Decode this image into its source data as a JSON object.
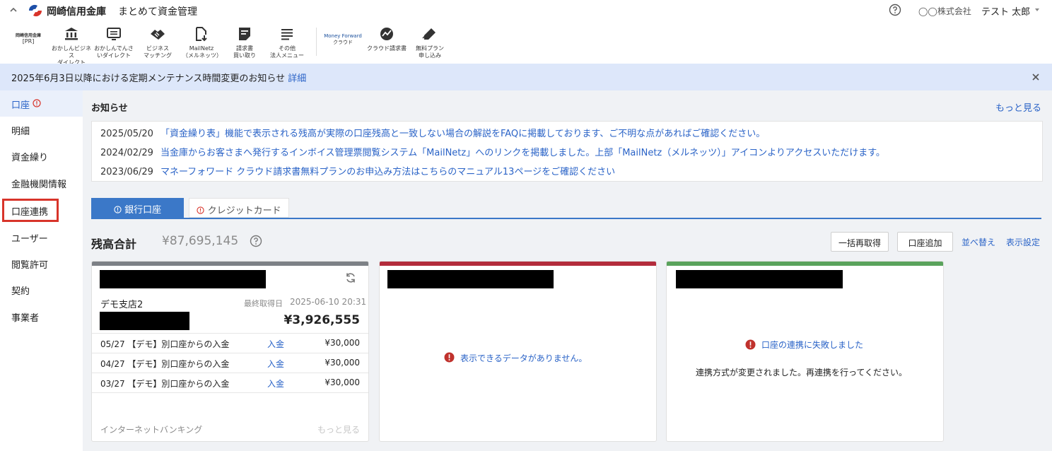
{
  "header": {
    "brand_name": "岡崎信用金庫",
    "app_name": "まとめて資金管理",
    "company": "◯◯株式会社",
    "user": "テスト 太郎",
    "accent": "#2a63c7"
  },
  "toolbar": {
    "pr_logo": "岡崎信用金庫",
    "pr_tag": "[PR]",
    "items": [
      {
        "icon": "bank-icon",
        "label": "おかしんビジネス\nダイレクト"
      },
      {
        "icon": "monitor-icon",
        "label": "おかしんでんさ\nいダイレクト"
      },
      {
        "icon": "handshake-icon",
        "label": "ビジネス\nマッチング"
      },
      {
        "icon": "document-download-icon",
        "label": "MailNetz\n（メルネッツ）"
      },
      {
        "icon": "invoice-icon",
        "label": "請求書\n買い取り"
      },
      {
        "icon": "menu-icon",
        "label": "その他\n法人メニュー"
      }
    ],
    "mf_brand": "Money Forward",
    "mf_sub": "クラウド",
    "mf_items": [
      {
        "icon": "mf-invoice-icon",
        "label": "クラウド請求書"
      },
      {
        "icon": "pen-icon",
        "label": "無料プラン\n申し込み"
      }
    ]
  },
  "notice": {
    "text": "2025年6月3日以降における定期メンテナンス時間変更のお知らせ",
    "link": "詳細"
  },
  "sidebar": {
    "items": [
      {
        "label": "口座",
        "active": true,
        "alert": true
      },
      {
        "label": "明細"
      },
      {
        "label": "資金繰り"
      },
      {
        "label": "金融機関情報"
      },
      {
        "label": "口座連携",
        "highlighted": true
      },
      {
        "label": "ユーザー"
      },
      {
        "label": "閲覧許可"
      },
      {
        "label": "契約"
      },
      {
        "label": "事業者"
      }
    ]
  },
  "announcements": {
    "title": "お知らせ",
    "more": "もっと見る",
    "items": [
      {
        "date": "2025/05/20",
        "text": "「資金繰り表」機能で表示される残高が実際の口座残高と一致しない場合の解説をFAQに掲載しております、ご不明な点があればご確認ください。"
      },
      {
        "date": "2024/02/29",
        "text": "当金庫からお客さまへ発行するインボイス管理票閲覧システム「MailNetz」へのリンクを掲載しました。上部「MailNetz（メルネッツ）」アイコンよりアクセスいただけます。"
      },
      {
        "date": "2023/06/29",
        "text": "マネーフォワード クラウド請求書無料プランのお申込み方法はこちらのマニュアル13ページをご確認ください"
      }
    ]
  },
  "tabs": {
    "bank": "銀行口座",
    "credit": "クレジットカード"
  },
  "balance": {
    "label": "残高合計",
    "value": "¥87,695,145",
    "refresh_all": "一括再取得",
    "add_account": "口座追加",
    "sort": "並べ替え",
    "display": "表示設定"
  },
  "cards": [
    {
      "bar_color": "#7d8186",
      "branch": "デモ支店2",
      "last_label": "最終取得日",
      "last_time": "2025-06-10 20:31",
      "balance": "¥3,926,555",
      "transactions": [
        {
          "desc": "05/27 【デモ】別口座からの入金",
          "kind": "入金",
          "amount": "¥30,000"
        },
        {
          "desc": "04/27 【デモ】別口座からの入金",
          "kind": "入金",
          "amount": "¥30,000"
        },
        {
          "desc": "03/27 【デモ】別口座からの入金",
          "kind": "入金",
          "amount": "¥30,000"
        }
      ],
      "footer_left": "インターネットバンキング",
      "footer_right": "もっと見る"
    },
    {
      "bar_color": "#b32c3c",
      "message": "表示できるデータがありません。"
    },
    {
      "bar_color": "#5aa35c",
      "message": "口座の連携に失敗しました",
      "sub": "連携方式が変更されました。再連携を行ってください。"
    }
  ]
}
